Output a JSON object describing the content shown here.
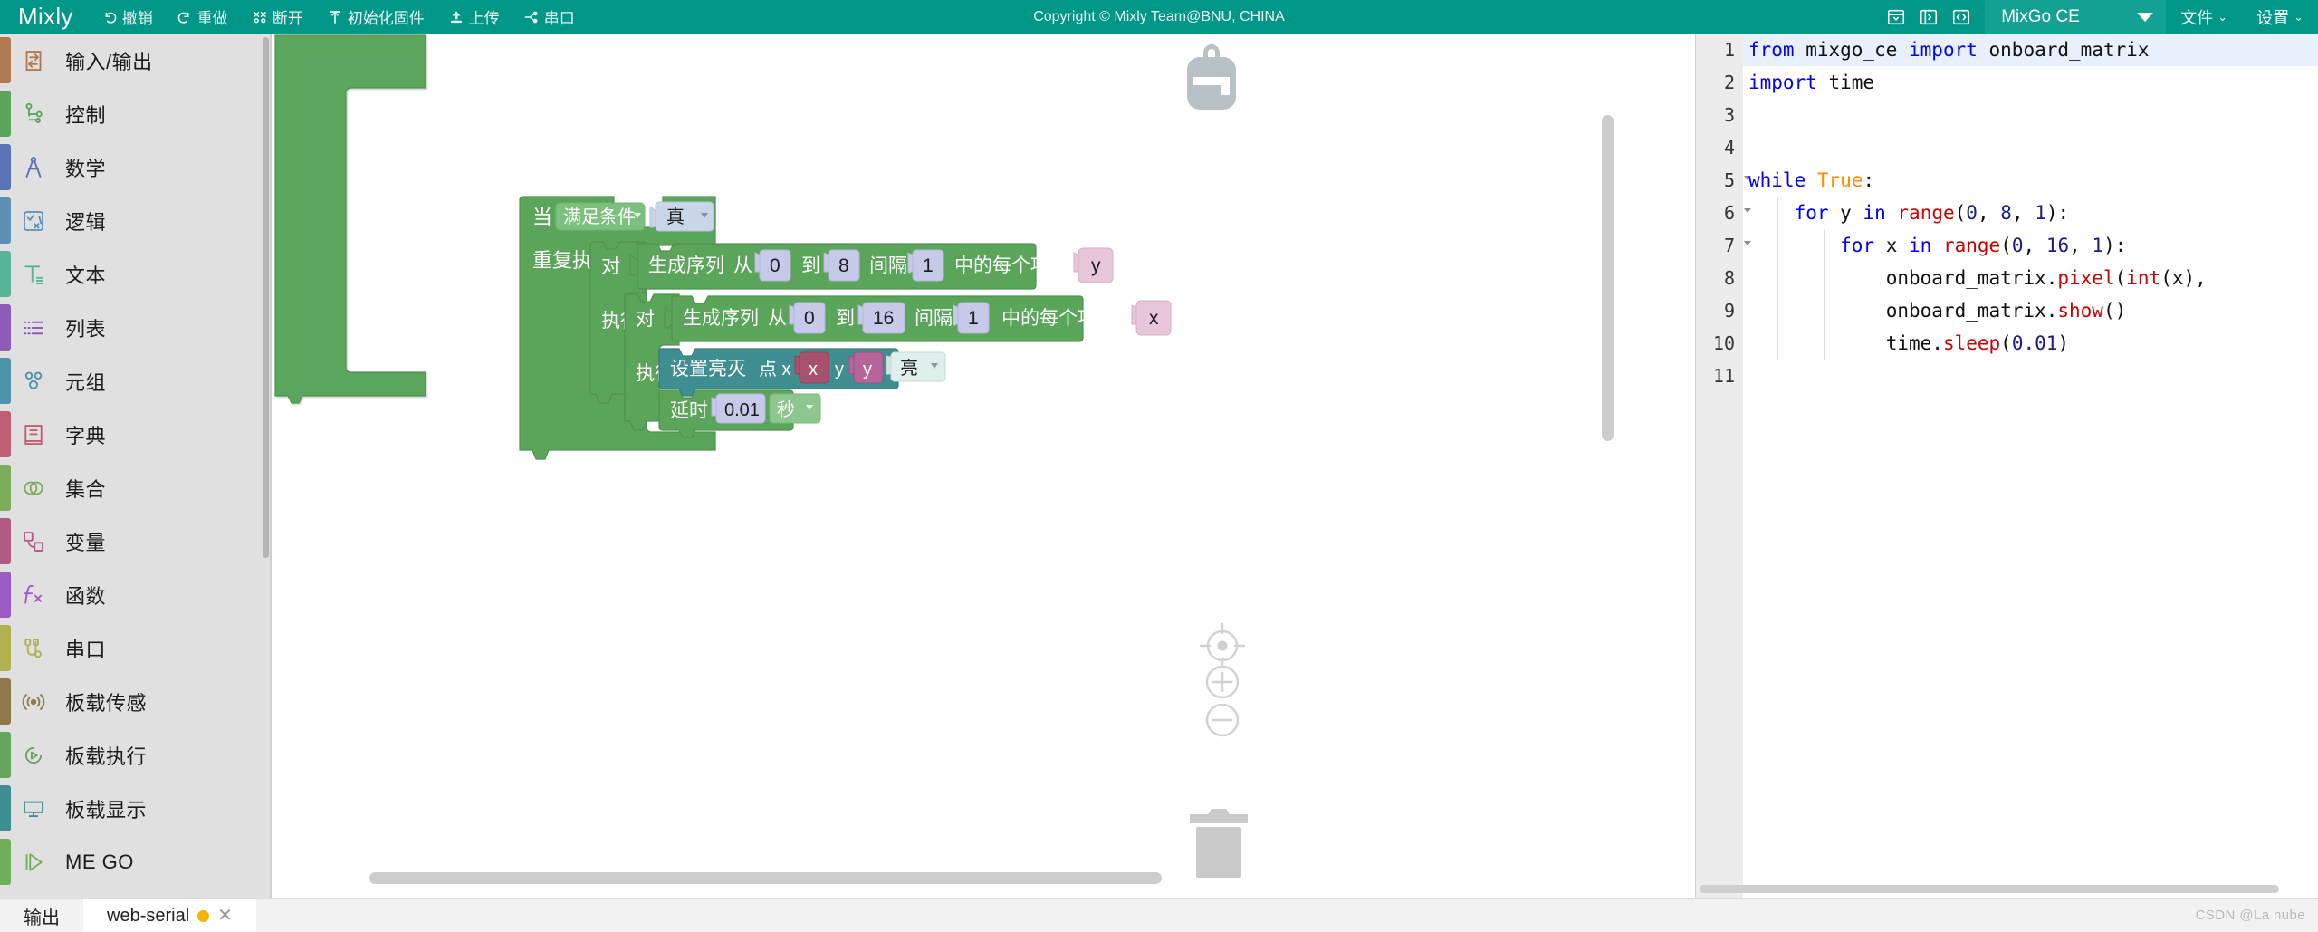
{
  "header": {
    "brand": "Mixly",
    "copyright": "Copyright © Mixly Team@BNU, CHINA",
    "tools": [
      {
        "label": "撤销",
        "icon": "undo-icon"
      },
      {
        "label": "重做",
        "icon": "redo-icon"
      },
      {
        "label": "断开",
        "icon": "disconnect-icon"
      },
      {
        "label": "初始化固件",
        "icon": "firmware-icon"
      },
      {
        "label": "上传",
        "icon": "upload-icon"
      },
      {
        "label": "串口",
        "icon": "serial-port-icon"
      }
    ],
    "right_icons": [
      {
        "name": "panel-bottom-icon"
      },
      {
        "name": "panel-right-icon"
      },
      {
        "name": "code-view-icon"
      }
    ],
    "board": "MixGo CE",
    "menus": [
      {
        "label": "文件"
      },
      {
        "label": "设置"
      }
    ],
    "accent": "#009688",
    "board_bg": "#12a193"
  },
  "sidebar": {
    "items": [
      {
        "label": "输入/输出",
        "color": "#b07a50",
        "icon": "io-icon"
      },
      {
        "label": "控制",
        "color": "#5ba55b",
        "icon": "control-icon"
      },
      {
        "label": "数学",
        "color": "#5b72b5",
        "icon": "math-icon"
      },
      {
        "label": "逻辑",
        "color": "#5b8fb5",
        "icon": "logic-icon"
      },
      {
        "label": "文本",
        "color": "#56b598",
        "icon": "text-icon"
      },
      {
        "label": "列表",
        "color": "#8e5bb5",
        "icon": "list-icon"
      },
      {
        "label": "元组",
        "color": "#4e93a8",
        "icon": "tuple-icon"
      },
      {
        "label": "字典",
        "color": "#bf5f74",
        "icon": "dict-icon"
      },
      {
        "label": "集合",
        "color": "#7aae5a",
        "icon": "set-icon"
      },
      {
        "label": "变量",
        "color": "#b05b84",
        "icon": "variable-icon"
      },
      {
        "label": "函数",
        "color": "#9b5bc4",
        "icon": "function-icon"
      },
      {
        "label": "串口",
        "color": "#b0b24f",
        "icon": "serial-icon"
      },
      {
        "label": "板载传感",
        "color": "#8d7a48",
        "icon": "sensor-icon"
      },
      {
        "label": "板载执行",
        "color": "#63a65c",
        "icon": "actuator-icon"
      },
      {
        "label": "板载显示",
        "color": "#3f8e91",
        "icon": "display-icon"
      },
      {
        "label": "ME GO",
        "color": "#6fae5a",
        "icon": "mego-icon"
      }
    ]
  },
  "workspace": {
    "icons": [
      {
        "name": "backpack-icon"
      },
      {
        "name": "center-target-icon"
      },
      {
        "name": "zoom-in-icon"
      },
      {
        "name": "zoom-out-icon"
      },
      {
        "name": "trash-icon"
      }
    ],
    "blocks": {
      "when_label": "当",
      "when_condition": "满足条件",
      "when_value": "真",
      "repeat_label": "重复执行",
      "for1": {
        "dui": "对",
        "seq_label": "生成序列",
        "from_label": "从",
        "from_value": "0",
        "to_label": "到",
        "to_value": "8",
        "step_label": "间隔为",
        "step_value": "1",
        "each_label": "中的每个项目",
        "var": "y",
        "do_label": "执行"
      },
      "for2": {
        "dui": "对",
        "seq_label": "生成序列",
        "from_label": "从",
        "from_value": "0",
        "to_label": "到",
        "to_value": "16",
        "step_label": "间隔为",
        "step_value": "1",
        "each_label": "中的每个项目",
        "var": "x",
        "do_label": "执行"
      },
      "pixel": {
        "label": "设置亮灭",
        "point_label": "点 x",
        "x_var": "x",
        "y_label": "y",
        "y_var": "y",
        "state": "亮"
      },
      "delay": {
        "label": "延时",
        "value": "0.01",
        "unit": "秒"
      }
    },
    "colors": {
      "control_green": "#5ba55b",
      "control_green_dark": "#4d9350",
      "display_teal": "#3f8e91",
      "field_lavender": "#c6c9e8",
      "field_pink": "#e8c6d9",
      "field_var_dark": "#a8516e",
      "field_mint": "#cfe6df",
      "field_pale_blue": "#c9d6e8"
    }
  },
  "code": {
    "lines": [
      {
        "n": "1",
        "fold": false,
        "active": true,
        "tokens": [
          {
            "t": "from",
            "c": "kw"
          },
          {
            "t": " mixgo_ce ",
            "c": "pln"
          },
          {
            "t": "import",
            "c": "kw"
          },
          {
            "t": " onboard_matrix",
            "c": "pln"
          }
        ]
      },
      {
        "n": "2",
        "fold": false,
        "active": false,
        "tokens": [
          {
            "t": "import",
            "c": "kw"
          },
          {
            "t": " time",
            "c": "pln"
          }
        ]
      },
      {
        "n": "3",
        "fold": false,
        "active": false,
        "tokens": []
      },
      {
        "n": "4",
        "fold": false,
        "active": false,
        "tokens": []
      },
      {
        "n": "5",
        "fold": true,
        "active": false,
        "tokens": [
          {
            "t": "while",
            "c": "kw"
          },
          {
            "t": " ",
            "c": "pln"
          },
          {
            "t": "True",
            "c": "bool"
          },
          {
            "t": ":",
            "c": "pln"
          }
        ]
      },
      {
        "n": "6",
        "fold": true,
        "active": false,
        "tokens": [
          {
            "t": "    ",
            "c": "pln"
          },
          {
            "t": "for",
            "c": "kw"
          },
          {
            "t": " y ",
            "c": "pln"
          },
          {
            "t": "in",
            "c": "kw"
          },
          {
            "t": " ",
            "c": "pln"
          },
          {
            "t": "range",
            "c": "fn"
          },
          {
            "t": "(",
            "c": "pln"
          },
          {
            "t": "0",
            "c": "num"
          },
          {
            "t": ", ",
            "c": "pln"
          },
          {
            "t": "8",
            "c": "num"
          },
          {
            "t": ", ",
            "c": "pln"
          },
          {
            "t": "1",
            "c": "num"
          },
          {
            "t": "):",
            "c": "pln"
          }
        ]
      },
      {
        "n": "7",
        "fold": true,
        "active": false,
        "tokens": [
          {
            "t": "        ",
            "c": "pln"
          },
          {
            "t": "for",
            "c": "kw"
          },
          {
            "t": " x ",
            "c": "pln"
          },
          {
            "t": "in",
            "c": "kw"
          },
          {
            "t": " ",
            "c": "pln"
          },
          {
            "t": "range",
            "c": "fn"
          },
          {
            "t": "(",
            "c": "pln"
          },
          {
            "t": "0",
            "c": "num"
          },
          {
            "t": ", ",
            "c": "pln"
          },
          {
            "t": "16",
            "c": "num"
          },
          {
            "t": ", ",
            "c": "pln"
          },
          {
            "t": "1",
            "c": "num"
          },
          {
            "t": "):",
            "c": "pln"
          }
        ]
      },
      {
        "n": "8",
        "fold": false,
        "active": false,
        "tokens": [
          {
            "t": "            onboard_matrix.",
            "c": "pln"
          },
          {
            "t": "pixel",
            "c": "fn"
          },
          {
            "t": "(",
            "c": "pln"
          },
          {
            "t": "int",
            "c": "fn"
          },
          {
            "t": "(x),",
            "c": "pln"
          }
        ]
      },
      {
        "n": "9",
        "fold": false,
        "active": false,
        "tokens": [
          {
            "t": "            onboard_matrix.",
            "c": "pln"
          },
          {
            "t": "show",
            "c": "fn"
          },
          {
            "t": "()",
            "c": "pln"
          }
        ]
      },
      {
        "n": "10",
        "fold": false,
        "active": false,
        "tokens": [
          {
            "t": "            time.",
            "c": "pln"
          },
          {
            "t": "sleep",
            "c": "fn"
          },
          {
            "t": "(",
            "c": "pln"
          },
          {
            "t": "0.01",
            "c": "num"
          },
          {
            "t": ")",
            "c": "pln"
          }
        ]
      },
      {
        "n": "11",
        "fold": false,
        "active": false,
        "tokens": []
      }
    ],
    "colors": {
      "keyword": "#0000ff",
      "function": "#cc0000",
      "boolean": "#ff8c00",
      "number": "#1a1a8c",
      "plain": "#111111",
      "active_line_bg": "#e8f0fb",
      "gutter_bg": "#ececec"
    }
  },
  "bottom": {
    "output_label": "输出",
    "serial_tab": "web-serial",
    "status_dot_color": "#f5b301",
    "close_glyph": "✕",
    "watermark": "CSDN @La nube"
  }
}
